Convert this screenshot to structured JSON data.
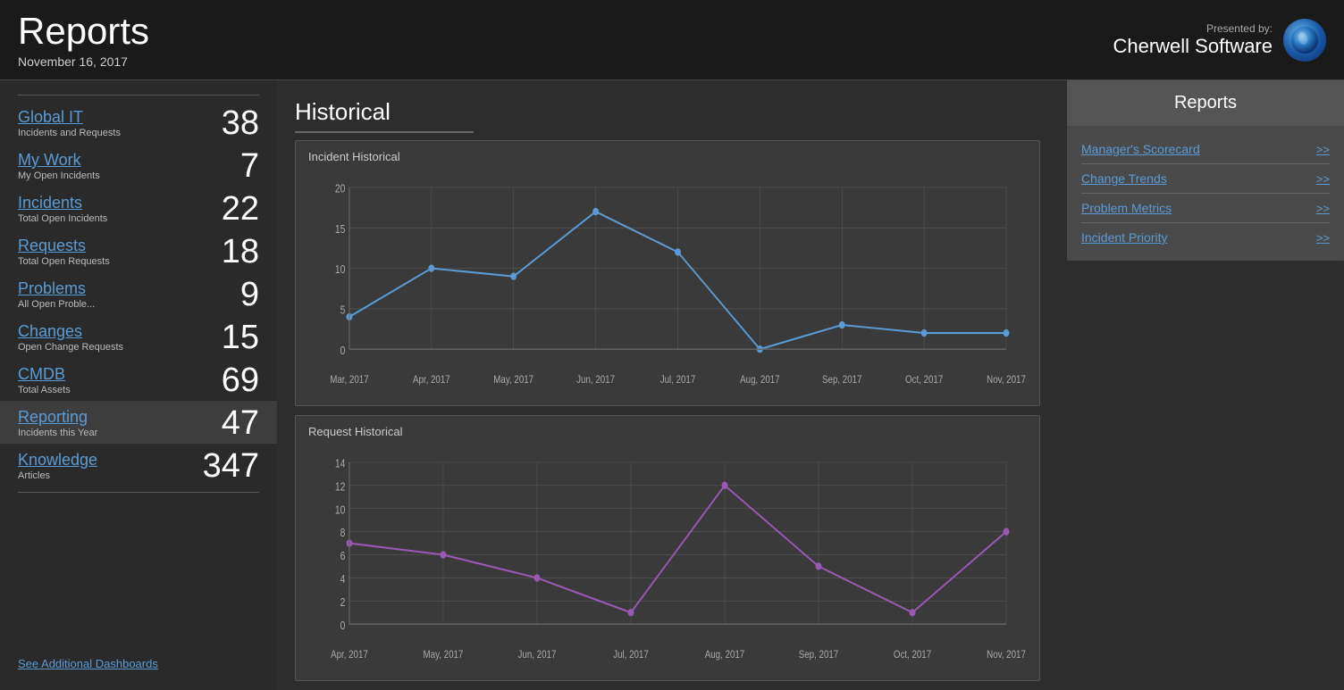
{
  "header": {
    "title": "Reports",
    "date": "November 16, 2017",
    "presented_by_label": "Presented by:",
    "presented_by_name": "Cherwell Software"
  },
  "sidebar": {
    "items": [
      {
        "id": "global-it",
        "name": "Global IT",
        "subtitle": "Incidents and Requests",
        "count": "38"
      },
      {
        "id": "my-work",
        "name": "My Work",
        "subtitle": "My Open Incidents",
        "count": "7"
      },
      {
        "id": "incidents",
        "name": "Incidents",
        "subtitle": "Total Open Incidents",
        "count": "22"
      },
      {
        "id": "requests",
        "name": "Requests",
        "subtitle": "Total Open Requests",
        "count": "18"
      },
      {
        "id": "problems",
        "name": "Problems",
        "subtitle": "All Open Proble...",
        "count": "9"
      },
      {
        "id": "changes",
        "name": "Changes",
        "subtitle": "Open Change Requests",
        "count": "15"
      },
      {
        "id": "cmdb",
        "name": "CMDB",
        "subtitle": "Total Assets",
        "count": "69"
      },
      {
        "id": "reporting",
        "name": "Reporting",
        "subtitle": "Incidents this Year",
        "count": "47",
        "active": true
      },
      {
        "id": "knowledge",
        "name": "Knowledge",
        "subtitle": "Articles",
        "count": "347"
      }
    ],
    "footer_link": "See Additional Dashboards"
  },
  "content": {
    "section_title": "Historical",
    "charts": [
      {
        "id": "incident-historical",
        "title": "Incident Historical",
        "color": "#5b9bd5",
        "y_max": 20,
        "y_ticks": [
          0,
          5,
          10,
          15,
          20
        ],
        "x_labels": [
          "Mar, 2017",
          "Apr, 2017",
          "May, 2017",
          "Jun, 2017",
          "Jul, 2017",
          "Aug, 2017",
          "Sep, 2017",
          "Oct, 2017",
          "Nov, 2017"
        ],
        "data_points": [
          4,
          10,
          9,
          17,
          12,
          0,
          3,
          2,
          2
        ]
      },
      {
        "id": "request-historical",
        "title": "Request Historical",
        "color": "#9b59b6",
        "y_max": 14,
        "y_ticks": [
          0,
          2,
          4,
          6,
          8,
          10,
          12,
          14
        ],
        "x_labels": [
          "Apr, 2017",
          "May, 2017",
          "Jun, 2017",
          "Jul, 2017",
          "Aug, 2017",
          "Sep, 2017",
          "Oct, 2017",
          "Nov, 2017"
        ],
        "data_points": [
          7,
          6,
          4,
          1,
          12,
          5,
          1,
          8
        ]
      }
    ]
  },
  "reports_panel": {
    "header": "Reports",
    "items": [
      {
        "name": "Manager's Scorecard",
        "arrow": ">>"
      },
      {
        "name": "Change Trends",
        "arrow": ">>"
      },
      {
        "name": "Problem Metrics",
        "arrow": ">>"
      },
      {
        "name": "Incident Priority",
        "arrow": ">>"
      }
    ]
  }
}
